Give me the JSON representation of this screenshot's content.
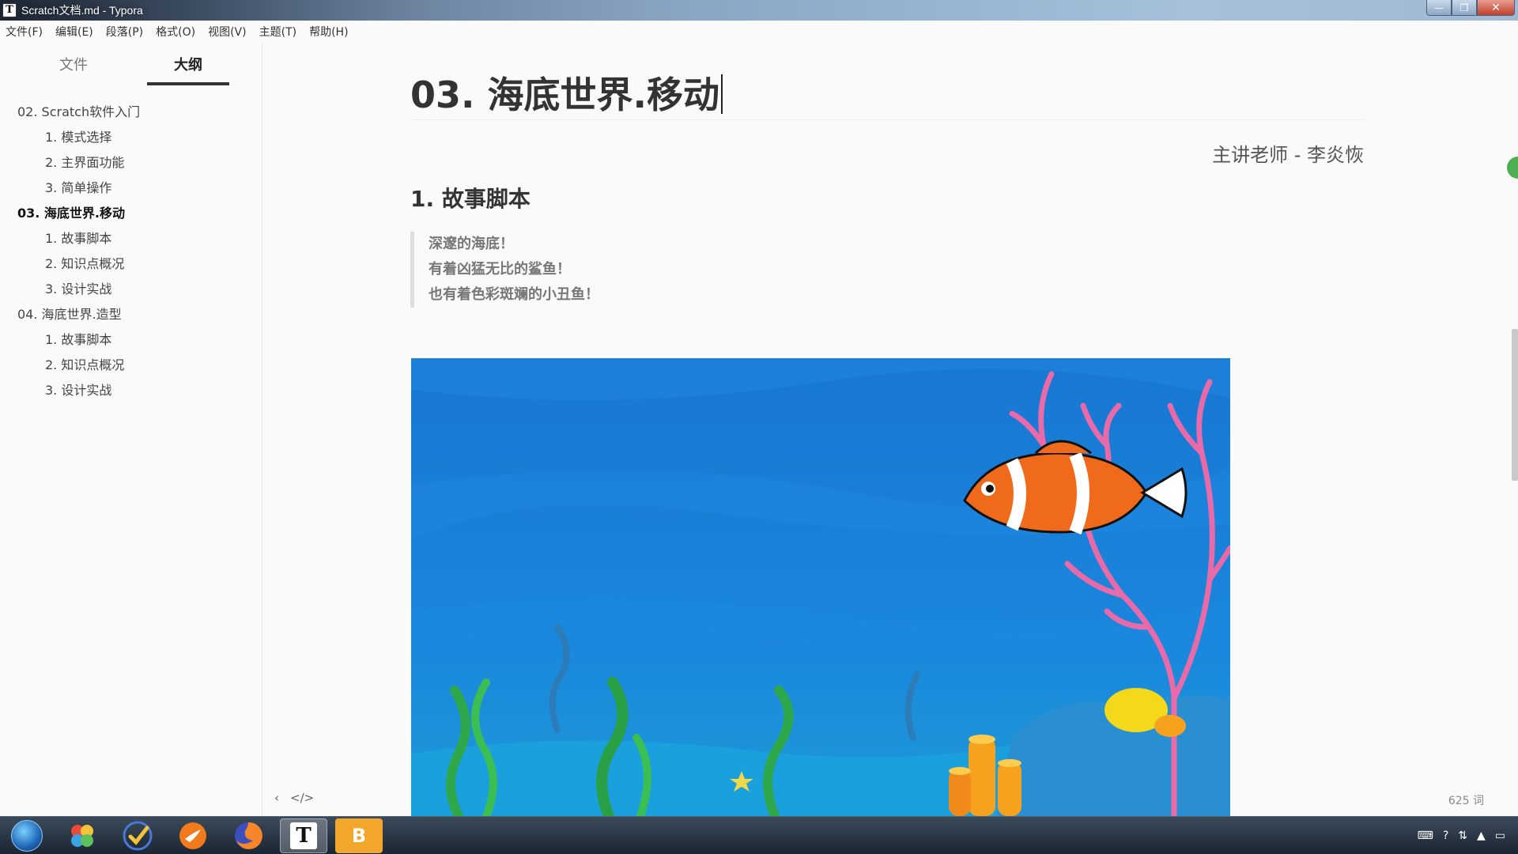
{
  "window": {
    "title": "Scratch文档.md - Typora",
    "app_icon": "T",
    "controls": {
      "minimize": "—",
      "maximize": "❐",
      "close": "✕"
    }
  },
  "menubar": {
    "items": [
      "文件(F)",
      "编辑(E)",
      "段落(P)",
      "格式(O)",
      "视图(V)",
      "主题(T)",
      "帮助(H)"
    ]
  },
  "sidebar": {
    "tabs": {
      "files": "文件",
      "outline": "大纲"
    },
    "outline": [
      {
        "label": "02. Scratch软件入门",
        "level": 1
      },
      {
        "label": "1. 模式选择",
        "level": 2
      },
      {
        "label": "2. 主界面功能",
        "level": 2
      },
      {
        "label": "3. 简单操作",
        "level": 2
      },
      {
        "label": "03. 海底世界.移动",
        "level": 1,
        "active": true
      },
      {
        "label": "1. 故事脚本",
        "level": 2
      },
      {
        "label": "2. 知识点概况",
        "level": 2
      },
      {
        "label": "3. 设计实战",
        "level": 2
      },
      {
        "label": "04. 海底世界.造型",
        "level": 1
      },
      {
        "label": "1. 故事脚本",
        "level": 2
      },
      {
        "label": "2. 知识点概况",
        "level": 2
      },
      {
        "label": "3. 设计实战",
        "level": 2
      }
    ]
  },
  "document": {
    "title": "03. 海底世界.移动",
    "author": "主讲老师 - 李炎恢",
    "section": "1. 故事脚本",
    "quote": [
      "深邃的海底！",
      "有着凶猛无比的鲨鱼！",
      "也有着色彩斑斓的小丑鱼！"
    ]
  },
  "footer": {
    "prev_icon": "‹",
    "source_icon": "</>",
    "word_count": "625 词"
  },
  "taskbar": {
    "icons": [
      "windows-start",
      "pinwheel",
      "check",
      "swift",
      "firefox",
      "typora",
      "notes"
    ],
    "typora_label": "T",
    "notes_label": "B"
  },
  "colors": {
    "ocean": "#1a7fd6",
    "ocean_light": "#2a92e6",
    "coral": "#e86aa8",
    "clownfish": "#f06a1c",
    "sand": "#1695d3"
  }
}
